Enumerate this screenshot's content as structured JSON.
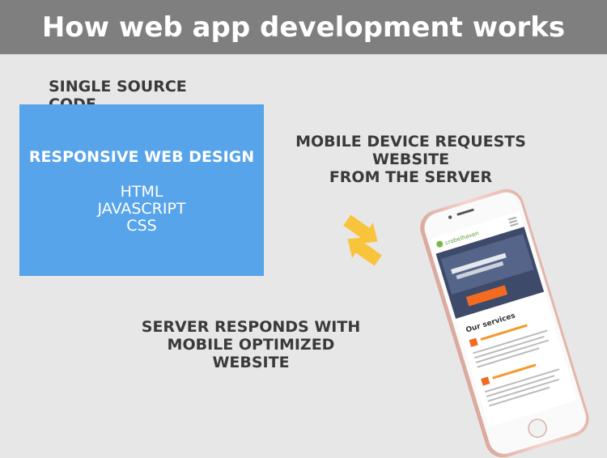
{
  "header": {
    "title": "How web app development works"
  },
  "source": {
    "label": "SINGLE SOURCE CODE",
    "box_title": "RESPONSIVE WEB DESIGN",
    "technologies": [
      "HTML",
      "JAVASCRIPT",
      "CSS"
    ]
  },
  "request": {
    "lines": [
      "MOBILE DEVICE REQUESTS",
      "WEBSITE",
      "FROM THE SERVER"
    ]
  },
  "response": {
    "lines": [
      "SERVER RESPONDS WITH",
      "MOBILE OPTIMIZED",
      "WEBSITE"
    ]
  },
  "phone_screen": {
    "brand": "crobelhaven",
    "section_title": "Our services"
  },
  "colors": {
    "header_bg": "#7f7f7f",
    "box_bg": "#58a4ea",
    "arrow": "#f8c43c",
    "phone_body": "#eec7bd"
  }
}
